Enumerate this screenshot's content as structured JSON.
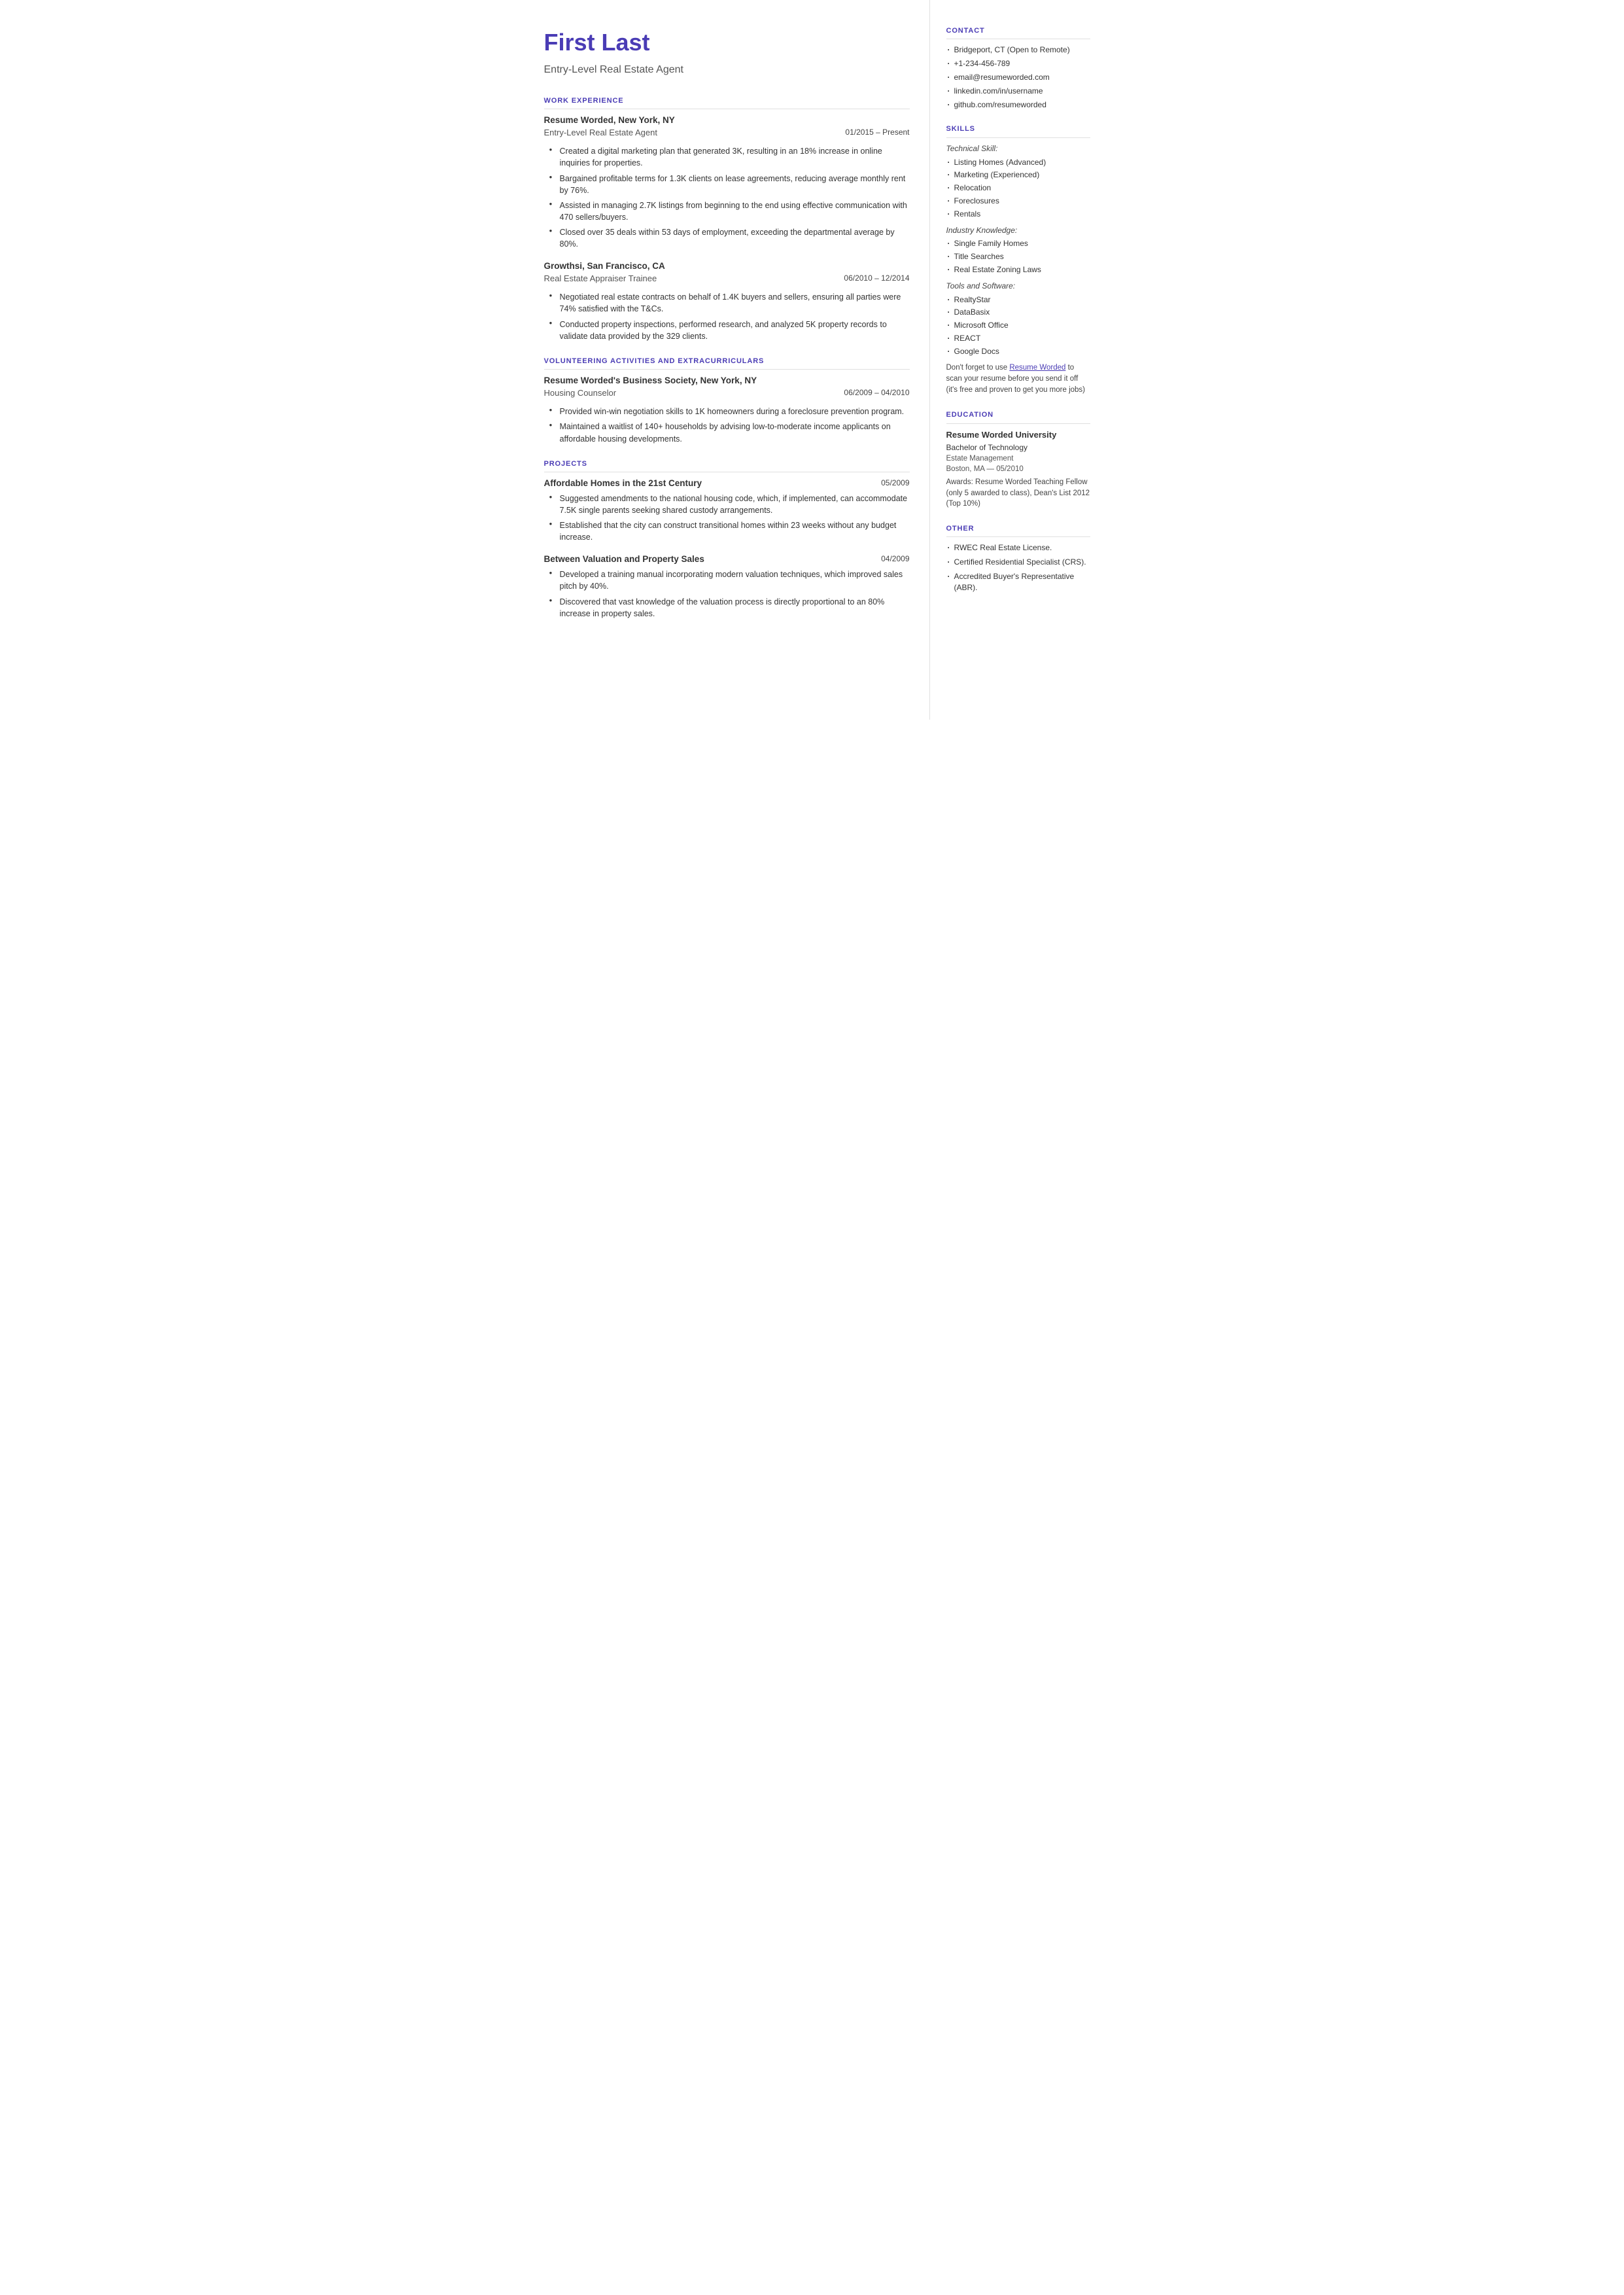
{
  "header": {
    "name": "First Last",
    "title": "Entry-Level Real Estate Agent"
  },
  "sections": {
    "work_experience_label": "WORK EXPERIENCE",
    "volunteering_label": "VOLUNTEERING ACTIVITIES AND EXTRACURRICULARS",
    "projects_label": "PROJECTS"
  },
  "jobs": [
    {
      "company": "Resume Worded, New York, NY",
      "role": "Entry-Level Real Estate Agent",
      "date": "01/2015 – Present",
      "bullets": [
        "Created a digital marketing plan that generated 3K, resulting in an 18% increase in online inquiries for properties.",
        "Bargained profitable terms for 1.3K clients on lease agreements, reducing average monthly rent by 76%.",
        "Assisted in managing 2.7K listings from beginning to the end using effective communication with 470 sellers/buyers.",
        "Closed over 35 deals within 53 days of employment, exceeding the departmental average by 80%."
      ]
    },
    {
      "company": "Growthsi, San Francisco, CA",
      "role": "Real Estate Appraiser Trainee",
      "date": "06/2010 – 12/2014",
      "bullets": [
        "Negotiated real estate contracts on behalf of 1.4K buyers and sellers, ensuring all parties were 74% satisfied with the T&Cs.",
        "Conducted property inspections, performed research, and analyzed 5K property records to validate data provided by the 329 clients."
      ]
    }
  ],
  "volunteering": [
    {
      "company": "Resume Worded's Business Society, New York, NY",
      "role": "Housing Counselor",
      "date": "06/2009 – 04/2010",
      "bullets": [
        "Provided win-win negotiation skills to 1K homeowners during a foreclosure prevention program.",
        "Maintained a waitlist of 140+ households by advising low-to-moderate income applicants on affordable housing developments."
      ]
    }
  ],
  "projects": [
    {
      "title": "Affordable Homes in the 21st Century",
      "date": "05/2009",
      "bullets": [
        "Suggested amendments to the national housing code, which, if implemented, can accommodate 7.5K single parents seeking shared custody arrangements.",
        "Established that the city can construct transitional homes within 23 weeks without any budget increase."
      ]
    },
    {
      "title": "Between Valuation and Property Sales",
      "date": "04/2009",
      "bullets": [
        "Developed a training manual incorporating modern valuation techniques, which improved sales pitch by 40%.",
        "Discovered that vast knowledge of the valuation process is directly proportional to an 80% increase in property sales."
      ]
    }
  ],
  "right": {
    "contact_label": "CONTACT",
    "contact_items": [
      "Bridgeport, CT (Open to Remote)",
      "+1-234-456-789",
      "email@resumeworded.com",
      "linkedin.com/in/username",
      "github.com/resumeworded"
    ],
    "skills_label": "SKILLS",
    "technical_skill_label": "Technical Skill:",
    "technical_skills": [
      "Listing Homes (Advanced)",
      "Marketing (Experienced)",
      "Relocation",
      "Foreclosures",
      "Rentals"
    ],
    "industry_knowledge_label": "Industry Knowledge:",
    "industry_skills": [
      "Single Family Homes",
      "Title Searches",
      "Real Estate Zoning Laws"
    ],
    "tools_label": "Tools and Software:",
    "tools_skills": [
      "RealtyStar",
      "DataBasix",
      "Microsoft Office",
      "REACT",
      "Google Docs"
    ],
    "promo_text_before": "Don't forget to use ",
    "promo_link_text": "Resume Worded",
    "promo_text_after": " to scan your resume before you send it off (it's free and proven to get you more jobs)",
    "education_label": "EDUCATION",
    "edu_school": "Resume Worded University",
    "edu_degree": "Bachelor of Technology",
    "edu_field": "Estate Management",
    "edu_location_date": "Boston, MA — 05/2010",
    "edu_awards": "Awards: Resume Worded Teaching Fellow (only 5 awarded to class), Dean's List 2012 (Top 10%)",
    "other_label": "OTHER",
    "other_items": [
      "RWEC Real Estate License.",
      "Certified Residential Specialist (CRS).",
      "Accredited Buyer's Representative (ABR)."
    ]
  }
}
